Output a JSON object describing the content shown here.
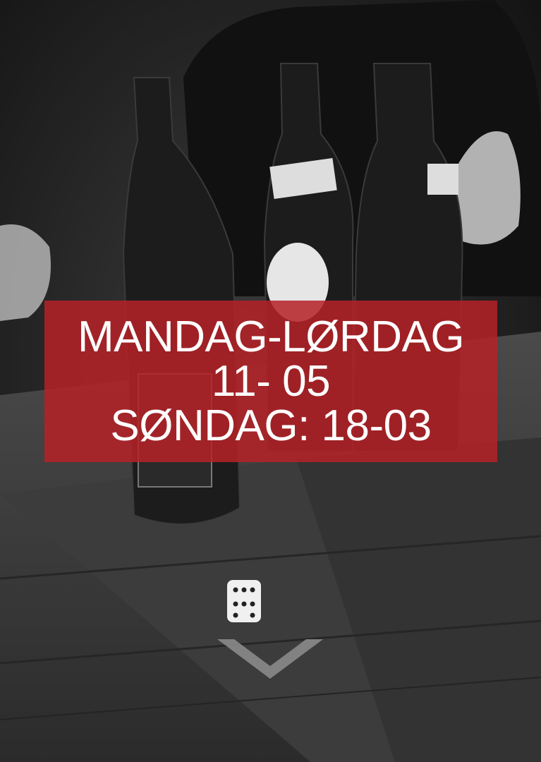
{
  "hours": {
    "weekdays_label": "MANDAG-LØRDAG",
    "weekdays_time": "11- 05",
    "sunday_line": "SØNDAG: 18-03"
  },
  "colors": {
    "banner": "#b42226",
    "text": "#ffffff",
    "chevron": "#8a8a8a"
  },
  "icons": {
    "scroll": "chevron-down-icon"
  }
}
